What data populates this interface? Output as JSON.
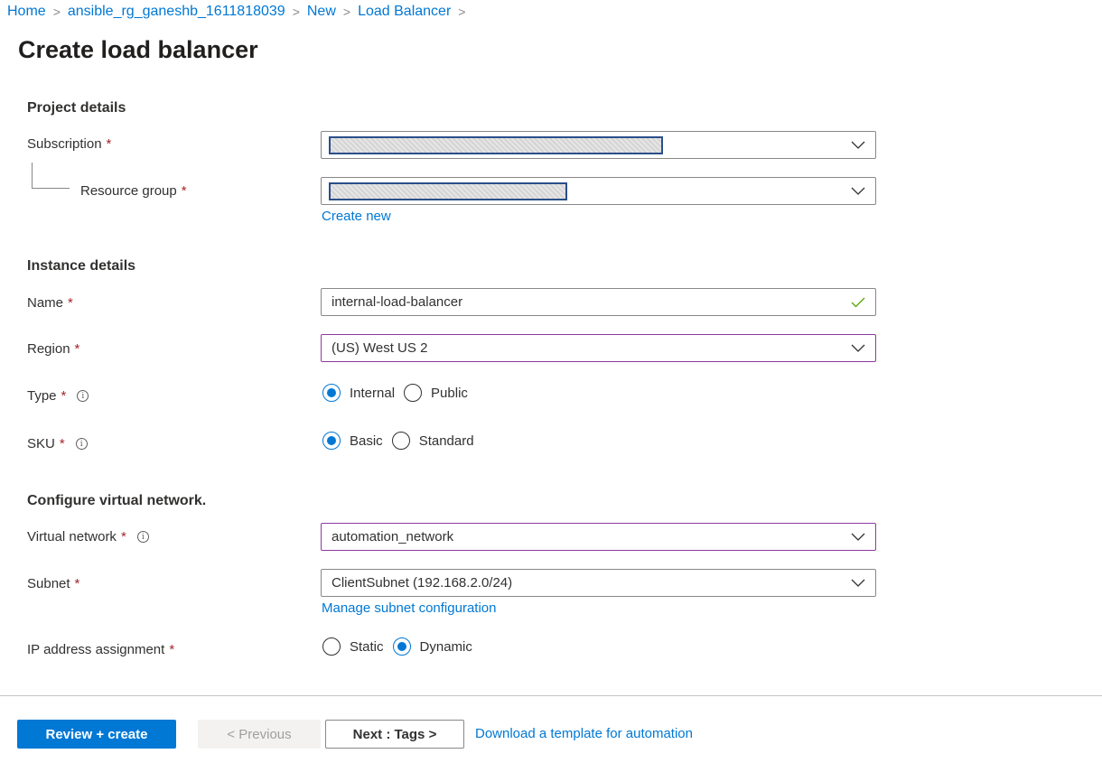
{
  "breadcrumb": [
    "Home",
    "ansible_rg_ganeshb_1611818039",
    "New",
    "Load Balancer"
  ],
  "page_title": "Create load balancer",
  "sections": {
    "project": "Project details",
    "instance": "Instance details",
    "network": "Configure virtual network."
  },
  "fields": {
    "subscription": {
      "label": "Subscription",
      "required": "*",
      "value": "[redacted]"
    },
    "resource_group": {
      "label": "Resource group",
      "required": "*",
      "value": "[redacted]",
      "link": "Create new"
    },
    "name": {
      "label": "Name",
      "required": "*",
      "value": "internal-load-balancer",
      "valid_icon": "checkmark-icon"
    },
    "region": {
      "label": "Region",
      "required": "*",
      "value": "(US) West US 2"
    },
    "type": {
      "label": "Type",
      "required": "*",
      "options": [
        "Internal",
        "Public"
      ],
      "selected": "Internal"
    },
    "sku": {
      "label": "SKU",
      "required": "*",
      "options": [
        "Basic",
        "Standard"
      ],
      "selected": "Basic"
    },
    "virtual_network": {
      "label": "Virtual network",
      "required": "*",
      "value": "automation_network"
    },
    "subnet": {
      "label": "Subnet",
      "required": "*",
      "value": "ClientSubnet (192.168.2.0/24)",
      "link": "Manage subnet configuration"
    },
    "ip_assignment": {
      "label": "IP address assignment",
      "required": "*",
      "options": [
        "Static",
        "Dynamic"
      ],
      "selected": "Dynamic"
    }
  },
  "info_glyph": "i",
  "footer": {
    "review_create": "Review + create",
    "previous": "< Previous",
    "next": "Next : Tags >",
    "download": "Download a template for automation"
  },
  "colors": {
    "accent": "#0078d4",
    "required": "#a4262c",
    "focus_border": "#8c3ba0",
    "valid": "#57a300"
  }
}
